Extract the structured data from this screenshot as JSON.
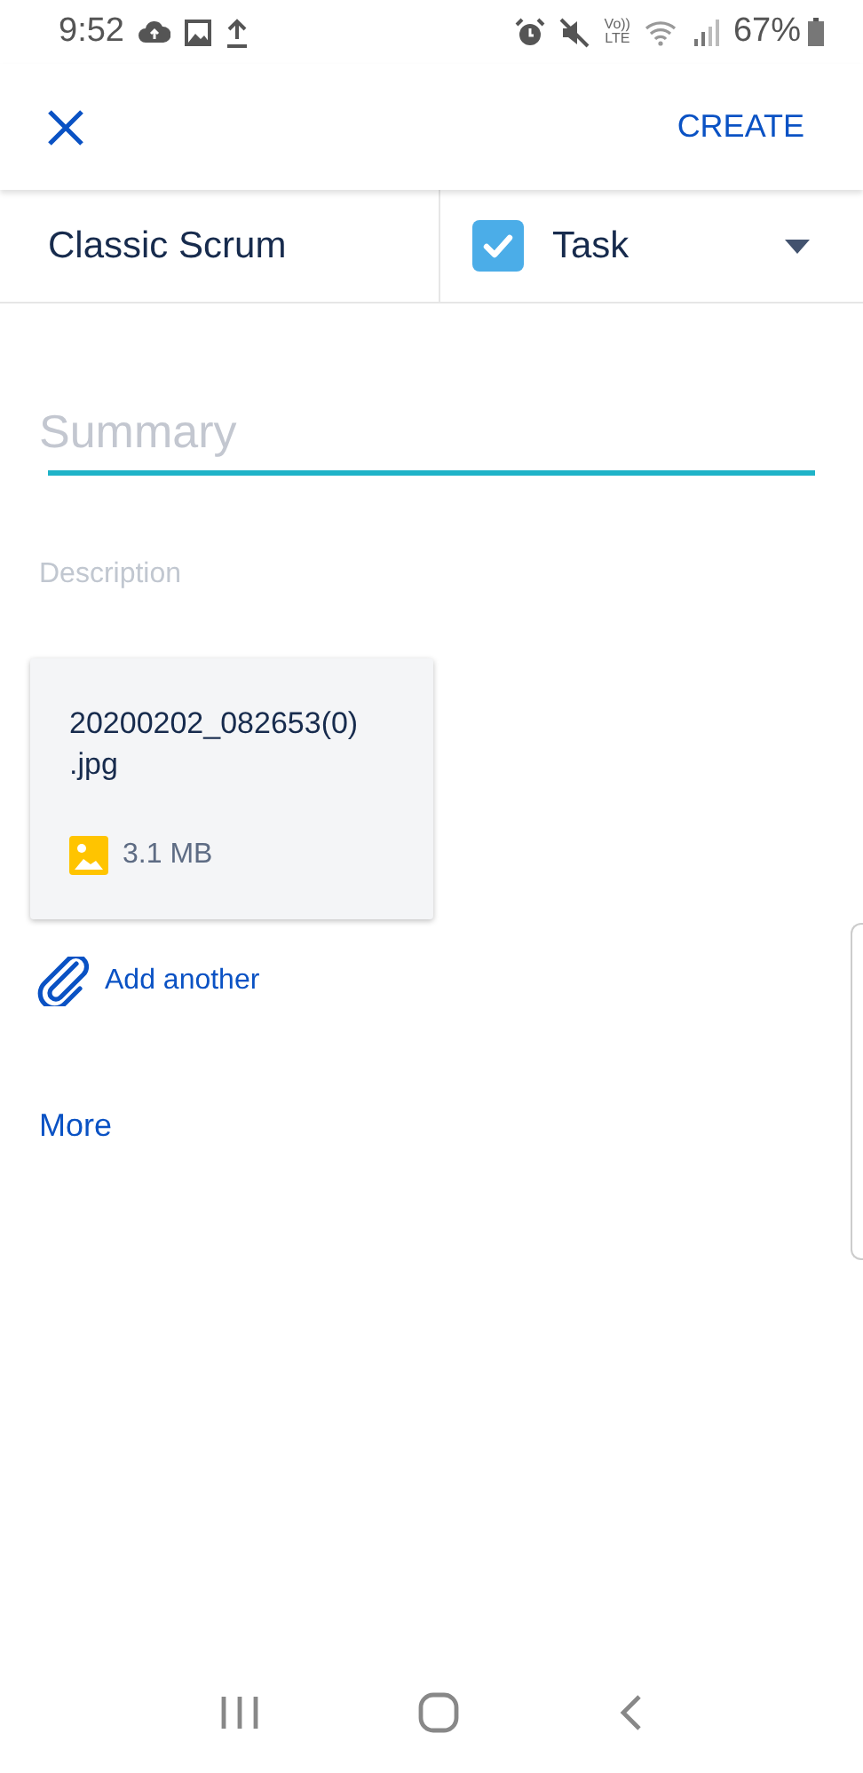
{
  "status_bar": {
    "time": "9:52",
    "network_label": [
      "Vo))",
      "LTE"
    ],
    "battery": "67%"
  },
  "header": {
    "action": "CREATE"
  },
  "project": "Classic Scrum",
  "issue_type": {
    "label": "Task"
  },
  "summary": {
    "placeholder": "Summary",
    "focused": true
  },
  "description": {
    "placeholder": "Description"
  },
  "attachments": [
    {
      "name": "20200202_082653(0)\n.jpg",
      "size": "3.1 MB"
    }
  ],
  "add_attachment": "Add another",
  "more": "More"
}
